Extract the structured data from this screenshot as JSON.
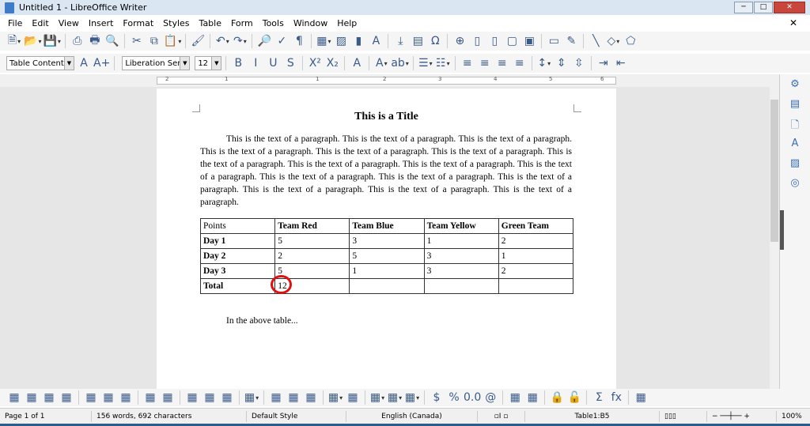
{
  "window": {
    "title": "Untitled 1 - LibreOffice Writer"
  },
  "menu": [
    "File",
    "Edit",
    "View",
    "Insert",
    "Format",
    "Styles",
    "Table",
    "Form",
    "Tools",
    "Window",
    "Help"
  ],
  "toolbar1": [
    "new-document-icon",
    "open-folder-icon",
    "save-icon",
    "|",
    "export-pdf-icon",
    "print-icon",
    "print-preview-icon",
    "|",
    "cut-icon",
    "copy-icon",
    "paste-icon",
    "|",
    "clone-formatting-icon",
    "|",
    "undo-icon",
    "redo-icon",
    "|",
    "find-replace-icon",
    "spellcheck-icon",
    "formatting-marks-icon",
    "|",
    "insert-table-icon",
    "insert-image-icon",
    "insert-chart-icon",
    "insert-textbox-icon",
    "|",
    "page-break-icon",
    "insert-field-icon",
    "special-character-icon",
    "|",
    "hyperlink-icon",
    "footnote-icon",
    "endnote-icon",
    "bookmark-icon",
    "cross-reference-icon",
    "|",
    "comment-icon",
    "track-changes-icon",
    "|",
    "line-icon",
    "shapes-icon",
    "draw-functions-icon"
  ],
  "formatting": {
    "paragraph_style": "Table Contents",
    "font_name": "Liberation Serif",
    "font_size": "12"
  },
  "toolbar2": [
    "update-style-icon",
    "new-style-icon",
    "|",
    "bold-icon",
    "italic-icon",
    "underline-icon",
    "strikethrough-icon",
    "|",
    "superscript-icon",
    "subscript-icon",
    "|",
    "clear-formatting-icon",
    "|",
    "font-color-icon",
    "highlight-icon",
    "|",
    "bullets-icon",
    "numbering-icon",
    "|",
    "align-left-icon",
    "align-center-icon",
    "align-right-icon",
    "justify-icon",
    "|",
    "line-spacing-icon",
    "increase-paragraph-spacing-icon",
    "decrease-paragraph-spacing-icon",
    "|",
    "increase-indent-icon",
    "decrease-indent-icon"
  ],
  "ruler": [
    "2",
    "1",
    "1",
    "2",
    "3",
    "4",
    "5",
    "6"
  ],
  "document": {
    "title": "This is a Title",
    "paragraph": "This is the text of a paragraph.  This is the text of a paragraph.  This is the text of a paragraph.  This is the text of a paragraph.  This is the text of a paragraph.  This is the text of a paragraph.  This is the text of a paragraph.  This is the text of a paragraph.  This is the text of a paragraph.  This is the text of a paragraph.  This is the text of a paragraph.  This is the text of a paragraph.  This is the text of a paragraph.  This is the text of a paragraph.  This is the text of a paragraph.  This is the text of a paragraph.",
    "table": [
      [
        "Points",
        "Team Red",
        "Team Blue",
        "Team Yellow",
        "Green Team"
      ],
      [
        "Day 1",
        "5",
        "3",
        "1",
        "2"
      ],
      [
        "Day 2",
        "2",
        "5",
        "3",
        "1"
      ],
      [
        "Day 3",
        "5",
        "1",
        "3",
        "2"
      ],
      [
        "Total",
        "12",
        "",
        "",
        ""
      ]
    ],
    "after_text": "In the above table..."
  },
  "sidebar": [
    "properties-icon",
    "styles-icon",
    "page-icon",
    "fontwork-icon",
    "gallery-icon",
    "navigator-icon"
  ],
  "table_toolbar": [
    "insert-rows-above-icon",
    "insert-rows-below-icon",
    "insert-columns-before-icon",
    "insert-columns-after-icon",
    "|",
    "delete-rows-icon",
    "delete-columns-icon",
    "delete-table-icon",
    "|",
    "select-table-icon",
    "select-cell-icon",
    "|",
    "merge-cells-icon",
    "split-cells-icon",
    "split-table-icon",
    "|",
    "autoformat-icon",
    "|",
    "align-top-icon",
    "center-vertically-icon",
    "align-bottom-icon",
    "|",
    "cell-background-icon",
    "protect-cells-icon",
    "|",
    "borders-icon",
    "border-style-icon",
    "border-color-icon",
    "|",
    "number-format-currency-icon",
    "number-format-percent-icon",
    "number-format-decimal-icon",
    "number-format-date-icon",
    "|",
    "insert-caption-icon",
    "sort-icon",
    "|",
    "protect-icon",
    "unprotect-icon",
    "|",
    "sum-icon",
    "formula-icon",
    "|",
    "table-properties-icon"
  ],
  "status": {
    "page": "Page 1 of 1",
    "words": "156 words, 692 characters",
    "style": "Default Style",
    "language": "English (Canada)",
    "table_cell": "Table1:B5",
    "zoom": "100%"
  }
}
